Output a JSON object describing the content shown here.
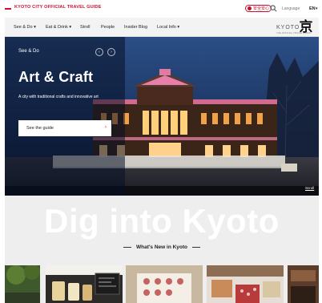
{
  "topbar": {
    "brand": "KYOTO CITY OFFICIAL TRAVEL GUIDE",
    "badge": "安全安心",
    "language_label": "Language",
    "language_value": "EN"
  },
  "nav": {
    "items": [
      {
        "label": "See & Do ▾"
      },
      {
        "label": "Eat & Drink ▾"
      },
      {
        "label": "Stroll"
      },
      {
        "label": "People"
      },
      {
        "label": "Insider Blog"
      },
      {
        "label": "Local Info ▾"
      }
    ],
    "logo_text": "KYOTO",
    "logo_sub": "THE OFFICIAL TRAVEL GUIDE",
    "logo_mark": "京"
  },
  "hero": {
    "eyebrow": "See & Do",
    "prev": "‹",
    "next": "›",
    "title": "Art & Craft",
    "subtitle": "A city with traditional crafts and innovative art",
    "cta": "See the guide",
    "cta_arrow": "›",
    "scroll": "Scroll"
  },
  "section": {
    "big": "Dig into Kyoto",
    "whats_new": "What's New in Kyoto"
  },
  "colors": {
    "brand_red": "#c8102e",
    "hero_sky": "#1b2a47"
  }
}
